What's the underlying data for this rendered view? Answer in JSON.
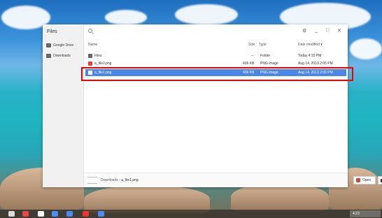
{
  "app": {
    "title": "Files"
  },
  "sidebar": {
    "items": [
      {
        "label": "Google Drive",
        "icon": "drive-icon"
      },
      {
        "label": "Downloads",
        "icon": "downloads-icon"
      }
    ]
  },
  "columns": {
    "name": "Name",
    "size": "Size",
    "type": "Type",
    "date": "Date modified ▾"
  },
  "files": [
    {
      "name": "Files",
      "size": "--",
      "type": "Folder",
      "date": "Today 4:15 PM"
    },
    {
      "name": "a_file2.png",
      "size": "436 KB",
      "type": "PNG image",
      "date": "Aug 14, 2013 2:05 PM"
    },
    {
      "name": "a_file1.png",
      "size": "436 KB",
      "type": "PNG image",
      "date": "Aug 14, 2013 2:05 PM"
    }
  ],
  "footer": {
    "crumb_root": "Downloads",
    "separator": "›",
    "crumb_file": "a_file1.png",
    "open_label": "Open"
  },
  "tray": {
    "time": "4:23"
  },
  "colors": {
    "selection": "#4b87e7",
    "highlight": "#e00000"
  }
}
